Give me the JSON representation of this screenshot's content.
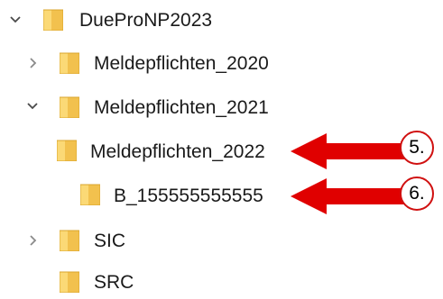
{
  "tree": {
    "items": [
      {
        "label": "DuePro​NP2023",
        "expander": "expanded"
      },
      {
        "label": "Meldepflichten_2020",
        "expander": "collapsed"
      },
      {
        "label": "Meldepflichten_2021",
        "expander": "expanded"
      },
      {
        "label": "Meldepflichten_2022",
        "expander": "none"
      },
      {
        "label": "B_155555555555",
        "expander": "none"
      },
      {
        "label": "SIC",
        "expander": "collapsed"
      },
      {
        "label": "SRC",
        "expander": "none"
      }
    ]
  },
  "callouts": [
    {
      "number": "5."
    },
    {
      "number": "6."
    }
  ],
  "colors": {
    "folder_fill": "#f2c14e",
    "folder_light": "#fbd976",
    "chevron": "#4a4a4a",
    "arrow": "#e00000"
  },
  "icons": {
    "folder": "folder-icon",
    "expanded": "chevron-down-icon",
    "collapsed": "chevron-right-icon"
  }
}
